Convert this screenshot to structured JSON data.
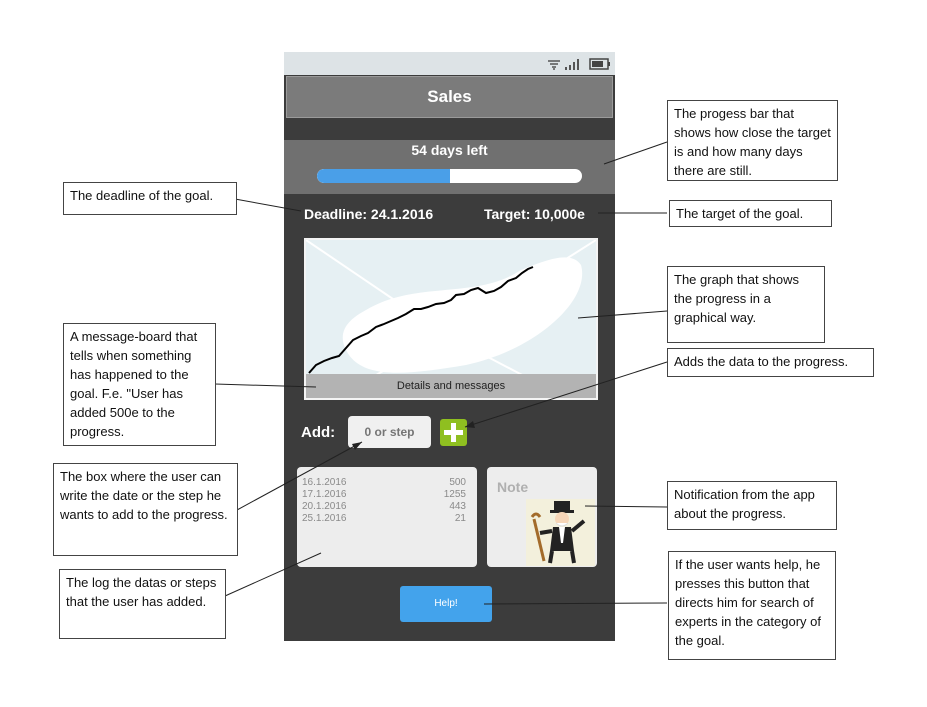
{
  "app": {
    "title": "Sales"
  },
  "status_bar": {
    "icons": [
      "wifi-icon",
      "signal-icon",
      "battery-icon"
    ]
  },
  "progress": {
    "days_left_text": "54 days left",
    "fraction": 0.5,
    "color": "#4a9fe8"
  },
  "goal": {
    "deadline_text": "Deadline: 24.1.2016",
    "target_text": "Target: 10,000e"
  },
  "graph": {
    "message_bar_label": "Details and messages"
  },
  "add": {
    "label": "Add:",
    "placeholder": "0 or step",
    "button_icon": "plus-icon"
  },
  "log": {
    "rows": [
      {
        "date": "16.1.2016",
        "value": "500"
      },
      {
        "date": "17.1.2016",
        "value": "1255"
      },
      {
        "date": "20.1.2016",
        "value": "443"
      },
      {
        "date": "25.1.2016",
        "value": "21"
      }
    ]
  },
  "note": {
    "label": "Note"
  },
  "help": {
    "label": "Help!"
  },
  "annotations": {
    "progress_bar": "The progess bar that shows how close the target is and how many days there are still.",
    "deadline": "The deadline of the goal.",
    "target": "The target of the goal.",
    "graph": "The graph that shows the progress in a graphical way.",
    "message_board": "A message-board that tells when something has happened to the goal. F.e. \"User has added 500e to the progress.",
    "add_button": "Adds the data to the progress.",
    "input_box": "The box where the user can write the date or the step he wants to add to the progress.",
    "notification": "Notification from the app about the progress.",
    "log": "The log the datas or steps that the user has added.",
    "help": "If the user wants help, he presses this button that directs him for search of experts in the category of the goal."
  },
  "colors": {
    "accent_green": "#8fbf20",
    "help_blue": "#43a3ec"
  }
}
